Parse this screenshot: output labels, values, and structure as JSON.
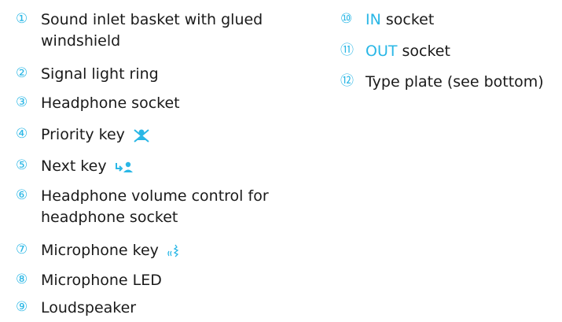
{
  "accent_color": "#2ab7e6",
  "left_items": [
    {
      "number": "①",
      "text": "Sound inlet basket with glued windshield"
    },
    {
      "number": "②",
      "text": "Signal light ring"
    },
    {
      "number": "③",
      "text": "Headphone socket"
    },
    {
      "number": "④",
      "text": "Priority key",
      "icon": "priority-key-icon"
    },
    {
      "number": "⑤",
      "text": "Next key",
      "icon": "next-key-icon"
    },
    {
      "number": "⑥",
      "text": "Headphone volume control for headphone socket"
    },
    {
      "number": "⑦",
      "text": "Microphone key",
      "icon": "microphone-key-icon"
    },
    {
      "number": "⑧",
      "text": "Microphone LED"
    },
    {
      "number": "⑨",
      "text": "Loudspeaker"
    }
  ],
  "right_items": [
    {
      "number": "⑩",
      "highlight": "IN",
      "text": " socket"
    },
    {
      "number": "⑪",
      "highlight": "OUT",
      "text": " socket"
    },
    {
      "number": "⑫",
      "text": "Type plate (see bottom)"
    }
  ]
}
